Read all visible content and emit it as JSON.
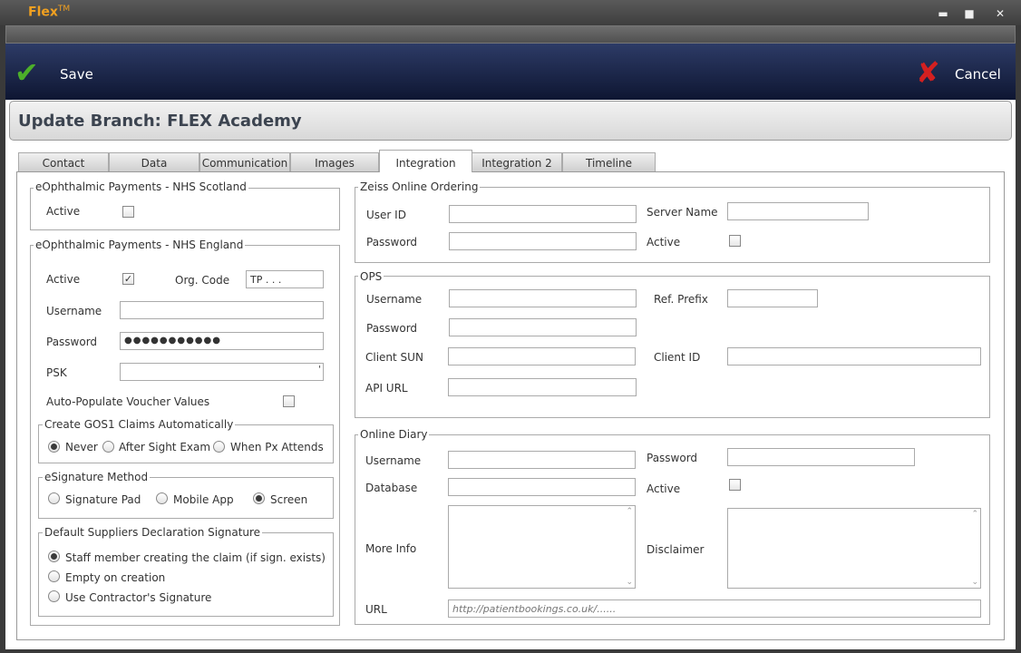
{
  "window": {
    "title": "Flex",
    "trademark": "TM",
    "minimize_glyph": "▬",
    "maximize_glyph": "■",
    "close_glyph": "✕"
  },
  "toolbar": {
    "save_label": "Save",
    "cancel_label": "Cancel",
    "save_glyph": "✔",
    "cancel_glyph": "✘",
    "check_color": "#4caf2a",
    "cross_color": "#d42020"
  },
  "header": {
    "title": "Update Branch: FLEX Academy"
  },
  "tabs": [
    {
      "label": "Contact"
    },
    {
      "label": "Data"
    },
    {
      "label": "Communication"
    },
    {
      "label": "Images"
    },
    {
      "label": "Integration"
    },
    {
      "label": "Integration 2"
    },
    {
      "label": "Timeline"
    }
  ],
  "nhs_scotland": {
    "legend": "eOphthalmic Payments - NHS Scotland",
    "active_label": "Active",
    "active": false
  },
  "nhs_england": {
    "legend": "eOphthalmic Payments - NHS England",
    "active_label": "Active",
    "active": true,
    "checkmark": "✓",
    "org_code_label": "Org. Code",
    "org_code_value": "TP . . .",
    "username_label": "Username",
    "username_value": "",
    "password_label": "Password",
    "password_value": "●●●●●●●●●●●",
    "psk_label": "PSK",
    "psk_value": "",
    "psk_overflow_mark": "'",
    "auto_populate_label": "Auto-Populate Voucher Values",
    "auto_populate": false
  },
  "gos1": {
    "legend": "Create GOS1 Claims Automatically",
    "options": [
      {
        "label": "Never",
        "selected": true
      },
      {
        "label": "After Sight Exam",
        "selected": false
      },
      {
        "label": "When Px Attends",
        "selected": false
      }
    ]
  },
  "esignature": {
    "legend": "eSignature Method",
    "options": [
      {
        "label": "Signature Pad",
        "selected": false
      },
      {
        "label": "Mobile App",
        "selected": false
      },
      {
        "label": "Screen",
        "selected": true
      }
    ]
  },
  "default_suppliers": {
    "legend": "Default Suppliers Declaration Signature",
    "options": [
      {
        "label": "Staff member creating the claim (if sign. exists)",
        "selected": true
      },
      {
        "label": "Empty on creation",
        "selected": false
      },
      {
        "label": "Use Contractor's Signature",
        "selected": false
      }
    ]
  },
  "zeiss": {
    "legend": "Zeiss Online Ordering",
    "user_id_label": "User ID",
    "user_id_value": "",
    "server_name_label": "Server Name",
    "server_name_value": "",
    "password_label": "Password",
    "password_value": "",
    "active_label": "Active",
    "active": false
  },
  "ops": {
    "legend": "OPS",
    "username_label": "Username",
    "username_value": "",
    "ref_prefix_label": "Ref. Prefix",
    "ref_prefix_value": "",
    "password_label": "Password",
    "password_value": "",
    "client_sun_label": "Client SUN",
    "client_sun_value": "",
    "client_id_label": "Client ID",
    "client_id_value": "",
    "api_url_label": "API URL",
    "api_url_value": ""
  },
  "online_diary": {
    "legend": "Online Diary",
    "username_label": "Username",
    "username_value": "",
    "password_label": "Password",
    "password_value": "",
    "database_label": "Database",
    "database_value": "",
    "active_label": "Active",
    "active": false,
    "more_info_label": "More Info",
    "disclaimer_label": "Disclaimer",
    "url_label": "URL",
    "url_placeholder": "http://patientbookings.co.uk/......",
    "scroll_up_glyph": "⌃",
    "scroll_down_glyph": "⌄"
  }
}
